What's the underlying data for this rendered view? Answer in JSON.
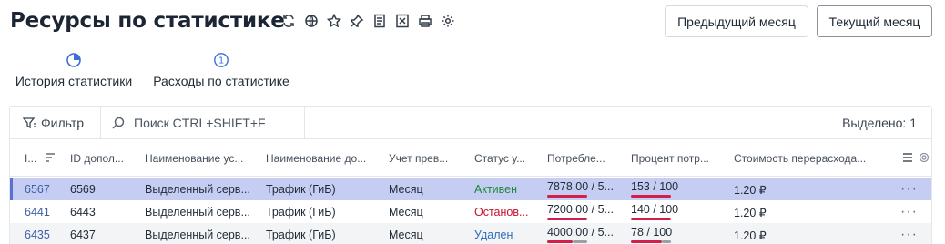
{
  "page": {
    "title": "Ресурсы по статистике",
    "toolbar_icons": [
      "refresh-icon",
      "globe-icon",
      "star-icon",
      "pin-icon",
      "document-icon",
      "excel-icon",
      "print-icon",
      "settings-icon"
    ]
  },
  "buttons": {
    "prev_month": "Предыдущий месяц",
    "current_month": "Текущий месяц"
  },
  "tabs": [
    {
      "label": "История статистики",
      "icon": "pie-chart-icon"
    },
    {
      "label": "Расходы по статистике",
      "icon": "circle-number-icon",
      "badge": "1"
    }
  ],
  "grid_toolbar": {
    "filter_label": "Фильтр",
    "search_placeholder": "Поиск CTRL+SHIFT+F",
    "selected_label": "Выделено: 1"
  },
  "columns": [
    "I...",
    "ID допол...",
    "Наименование ус...",
    "Наименование до...",
    "Учет прев...",
    "Статус у...",
    "Потребле...",
    "Процент потр...",
    "Стоимость перерасхода..."
  ],
  "rows": [
    {
      "id": "6567",
      "add_id": "6569",
      "service": "Выделенный серв...",
      "extra": "Трафик (ГиБ)",
      "accounting": "Месяц",
      "status": "Активен",
      "consumption": "7878.00 / 5...",
      "percent": "153 / 100",
      "cost": "1.20 ₽",
      "selected": true,
      "status_kind": "active"
    },
    {
      "id": "6441",
      "add_id": "6443",
      "service": "Выделенный серв...",
      "extra": "Трафик (ГиБ)",
      "accounting": "Месяц",
      "status": "Останов...",
      "consumption": "7200.00 / 5...",
      "percent": "140 / 100",
      "cost": "1.20 ₽",
      "selected": false,
      "status_kind": "stopped"
    },
    {
      "id": "6435",
      "add_id": "6437",
      "service": "Выделенный серв...",
      "extra": "Трафик (ГиБ)",
      "accounting": "Месяц",
      "status": "Удален",
      "consumption": "4000.00 / 5...",
      "percent": "78 / 100",
      "cost": "1.20 ₽",
      "selected": false,
      "status_kind": "deleted"
    }
  ],
  "row_actions_label": "···",
  "colors": {
    "selected_row": "#c6cdf3",
    "accent": "#5c6fd6",
    "status_active": "#1a8a3b",
    "status_stopped": "#c8102e",
    "status_deleted": "#2a6fb8",
    "usage_bar": "#cf1f4a"
  }
}
